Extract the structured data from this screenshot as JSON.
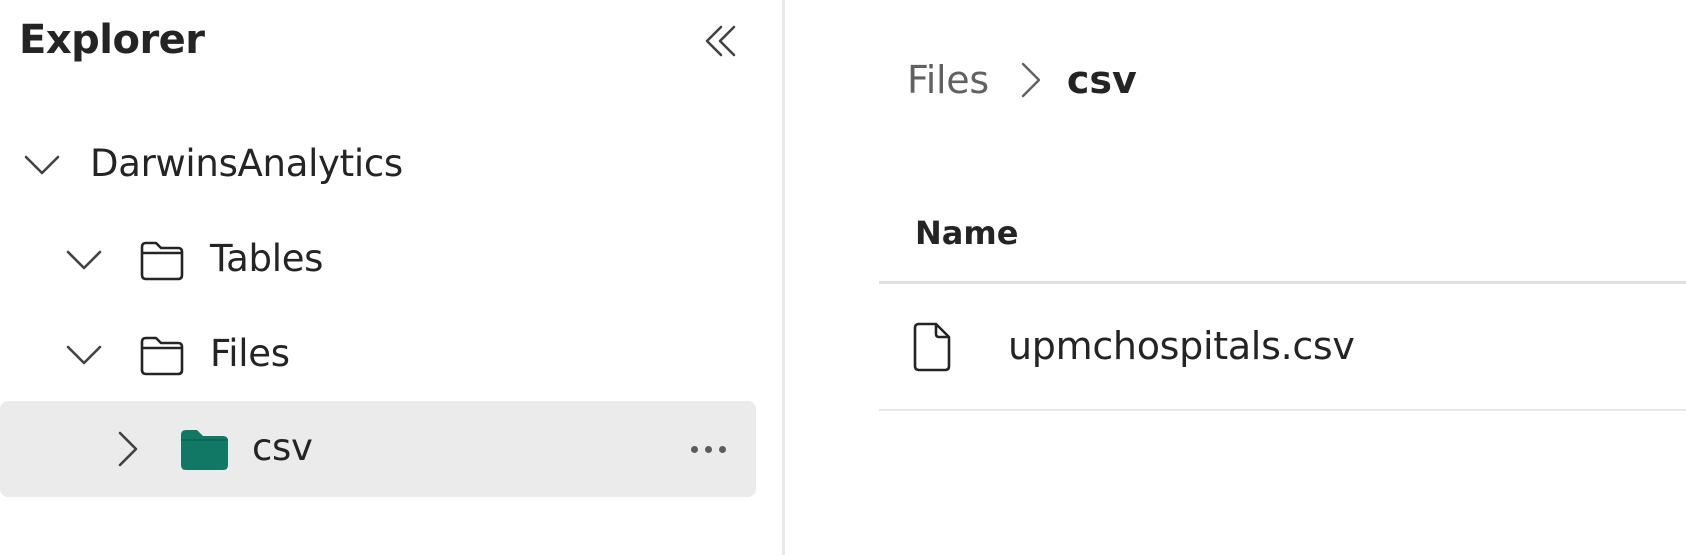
{
  "explorer": {
    "title": "Explorer",
    "collapse_icon": "double-chevron-left-icon",
    "tree": {
      "root": {
        "label": "DarwinsAnalytics",
        "expanded": true
      },
      "tables": {
        "label": "Tables",
        "expanded": true,
        "icon": "folder-outline-icon"
      },
      "files": {
        "label": "Files",
        "expanded": true,
        "icon": "folder-outline-icon"
      },
      "csv": {
        "label": "csv",
        "expanded": false,
        "selected": true,
        "icon": "folder-filled-icon",
        "more_icon": "more-horizontal-icon"
      }
    }
  },
  "main": {
    "breadcrumb": {
      "items": [
        "Files",
        "csv"
      ]
    },
    "table": {
      "columns": [
        "Name"
      ],
      "rows": [
        {
          "name": "upmchospitals.csv",
          "icon": "document-icon"
        }
      ]
    }
  },
  "colors": {
    "selected_bg": "#ebebeb",
    "accent_folder": "#117865",
    "text_primary": "#242424",
    "text_secondary": "#616161"
  }
}
